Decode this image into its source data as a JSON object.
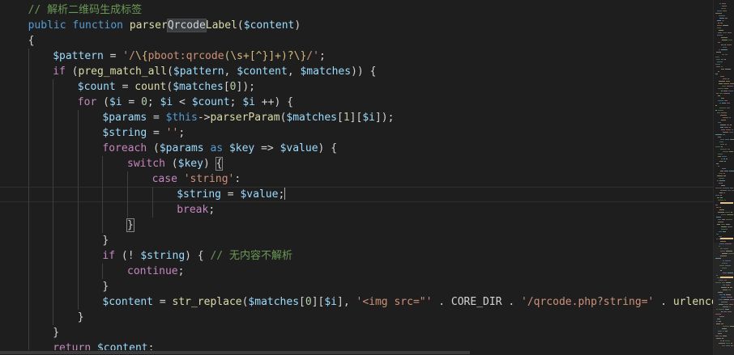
{
  "editor": {
    "lines": [
      {
        "indent": 1,
        "tokens": [
          [
            "comment",
            "// 解析二维码生成标签"
          ]
        ]
      },
      {
        "indent": 1,
        "tokens": [
          [
            "kw",
            "public"
          ],
          [
            "punc",
            " "
          ],
          [
            "kw",
            "function"
          ],
          [
            "punc",
            " "
          ],
          [
            "fn",
            "parser"
          ],
          [
            "hl",
            "Qrcode"
          ],
          [
            "fn",
            "Label"
          ],
          [
            "punc",
            "("
          ],
          [
            "var",
            "$content"
          ],
          [
            "punc",
            ")"
          ]
        ]
      },
      {
        "indent": 1,
        "tokens": [
          [
            "punc",
            "{"
          ]
        ]
      },
      {
        "indent": 2,
        "tokens": [
          [
            "var",
            "$pattern"
          ],
          [
            "punc",
            " = "
          ],
          [
            "str",
            "'/"
          ],
          [
            "rx",
            "\\{"
          ],
          [
            "str",
            "pboot:qrcode"
          ],
          [
            "rx",
            "(\\s+[^}]+)?\\}"
          ],
          [
            "str",
            "/'"
          ],
          [
            "punc",
            ";"
          ]
        ]
      },
      {
        "indent": 2,
        "tokens": [
          [
            "ctrl",
            "if"
          ],
          [
            "punc",
            " ("
          ],
          [
            "fn",
            "preg_match_all"
          ],
          [
            "punc",
            "("
          ],
          [
            "var",
            "$pattern"
          ],
          [
            "punc",
            ", "
          ],
          [
            "var",
            "$content"
          ],
          [
            "punc",
            ", "
          ],
          [
            "var",
            "$matches"
          ],
          [
            "punc",
            ")) {"
          ]
        ]
      },
      {
        "indent": 3,
        "tokens": [
          [
            "var",
            "$count"
          ],
          [
            "punc",
            " = "
          ],
          [
            "fn",
            "count"
          ],
          [
            "punc",
            "("
          ],
          [
            "var",
            "$matches"
          ],
          [
            "punc",
            "["
          ],
          [
            "num",
            "0"
          ],
          [
            "punc",
            "]);"
          ]
        ]
      },
      {
        "indent": 3,
        "tokens": [
          [
            "ctrl",
            "for"
          ],
          [
            "punc",
            " ("
          ],
          [
            "var",
            "$i"
          ],
          [
            "punc",
            " = "
          ],
          [
            "num",
            "0"
          ],
          [
            "punc",
            "; "
          ],
          [
            "var",
            "$i"
          ],
          [
            "punc",
            " < "
          ],
          [
            "var",
            "$count"
          ],
          [
            "punc",
            "; "
          ],
          [
            "var",
            "$i"
          ],
          [
            "punc",
            " ++) {"
          ]
        ]
      },
      {
        "indent": 4,
        "tokens": [
          [
            "var",
            "$params"
          ],
          [
            "punc",
            " = "
          ],
          [
            "kw",
            "$this"
          ],
          [
            "punc",
            "->"
          ],
          [
            "fn",
            "parserParam"
          ],
          [
            "punc",
            "("
          ],
          [
            "var",
            "$matches"
          ],
          [
            "punc",
            "["
          ],
          [
            "num",
            "1"
          ],
          [
            "punc",
            "]["
          ],
          [
            "var",
            "$i"
          ],
          [
            "punc",
            "]);"
          ]
        ]
      },
      {
        "indent": 4,
        "tokens": [
          [
            "var",
            "$string"
          ],
          [
            "punc",
            " = "
          ],
          [
            "str",
            "''"
          ],
          [
            "punc",
            ";"
          ]
        ]
      },
      {
        "indent": 4,
        "tokens": [
          [
            "ctrl",
            "foreach"
          ],
          [
            "punc",
            " ("
          ],
          [
            "var",
            "$params"
          ],
          [
            "punc",
            " "
          ],
          [
            "kw",
            "as"
          ],
          [
            "punc",
            " "
          ],
          [
            "var",
            "$key"
          ],
          [
            "punc",
            " => "
          ],
          [
            "var",
            "$value"
          ],
          [
            "punc",
            ") {"
          ]
        ]
      },
      {
        "indent": 5,
        "tokens": [
          [
            "ctrl",
            "switch"
          ],
          [
            "punc",
            " ("
          ],
          [
            "var",
            "$key"
          ],
          [
            "punc",
            ") "
          ],
          [
            "br",
            "{"
          ]
        ]
      },
      {
        "indent": 6,
        "tokens": [
          [
            "ctrl",
            "case"
          ],
          [
            "punc",
            " "
          ],
          [
            "str",
            "'string'"
          ],
          [
            "punc",
            ":"
          ]
        ]
      },
      {
        "indent": 7,
        "current": true,
        "tokens": [
          [
            "var",
            "$string"
          ],
          [
            "punc",
            " = "
          ],
          [
            "var",
            "$value"
          ],
          [
            "punc",
            ";"
          ],
          [
            "cursor",
            ""
          ]
        ]
      },
      {
        "indent": 7,
        "tokens": [
          [
            "ctrl",
            "break"
          ],
          [
            "punc",
            ";"
          ]
        ]
      },
      {
        "indent": 5,
        "tokens": [
          [
            "br",
            "}"
          ]
        ]
      },
      {
        "indent": 4,
        "tokens": [
          [
            "punc",
            "}"
          ]
        ]
      },
      {
        "indent": 4,
        "tokens": [
          [
            "ctrl",
            "if"
          ],
          [
            "punc",
            " (! "
          ],
          [
            "var",
            "$string"
          ],
          [
            "punc",
            ") { "
          ],
          [
            "comment",
            "// 无内容不解析"
          ]
        ]
      },
      {
        "indent": 5,
        "tokens": [
          [
            "ctrl",
            "continue"
          ],
          [
            "punc",
            ";"
          ]
        ]
      },
      {
        "indent": 4,
        "tokens": [
          [
            "punc",
            "}"
          ]
        ]
      },
      {
        "indent": 4,
        "tokens": [
          [
            "var",
            "$content"
          ],
          [
            "punc",
            " = "
          ],
          [
            "fn",
            "str_replace"
          ],
          [
            "punc",
            "("
          ],
          [
            "var",
            "$matches"
          ],
          [
            "punc",
            "["
          ],
          [
            "num",
            "0"
          ],
          [
            "punc",
            "]["
          ],
          [
            "var",
            "$i"
          ],
          [
            "punc",
            "], "
          ],
          [
            "str",
            "'<img src=\"'"
          ],
          [
            "punc",
            " . CORE_DIR . "
          ],
          [
            "str",
            "'/qrcode.php?string='"
          ],
          [
            "punc",
            " . "
          ],
          [
            "fn",
            "urlencode"
          ]
        ]
      },
      {
        "indent": 3,
        "tokens": [
          [
            "punc",
            "}"
          ]
        ]
      },
      {
        "indent": 2,
        "tokens": [
          [
            "punc",
            "}"
          ]
        ]
      },
      {
        "indent": 2,
        "tokens": [
          [
            "ctrl",
            "return"
          ],
          [
            "punc",
            " "
          ],
          [
            "var",
            "$content"
          ],
          [
            "punc",
            ";"
          ]
        ]
      }
    ]
  },
  "colors": {
    "background": "#1e1e1e",
    "comment": "#6a9955",
    "keyword": "#569cd6",
    "control": "#c586c0",
    "function": "#dcdcaa",
    "variable": "#9cdcfe",
    "string": "#ce9178",
    "number": "#b5cea8"
  }
}
